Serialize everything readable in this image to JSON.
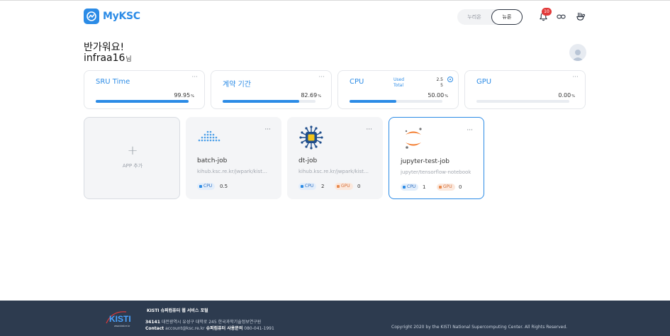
{
  "header": {
    "logo_text": "MyKSC",
    "toggle": {
      "left_label": "누리온",
      "right_label": "뉴론",
      "active": "뉴론"
    },
    "notification_count": "10",
    "icons": [
      "bell-icon",
      "link-icon",
      "user-menu-icon"
    ]
  },
  "greeting": {
    "line1": "반가워요!",
    "username": "infraa16",
    "suffix": "님"
  },
  "stats": [
    {
      "title": "SRU Time",
      "value": "99.95",
      "unit": "%",
      "progress": 0.9995
    },
    {
      "title": "계약 기간",
      "value": "82.69",
      "unit": "%",
      "progress": 0.8269
    },
    {
      "title": "CPU",
      "used_label": "Used",
      "used_value": "2.5",
      "total_label": "Total",
      "total_value": "5",
      "value": "50.00",
      "unit": "%",
      "progress": 0.5
    },
    {
      "title": "GPU",
      "value": "0.00",
      "unit": "%",
      "progress": 0
    }
  ],
  "more_glyph": "···",
  "add_app": {
    "plus": "+",
    "label": "APP 추가"
  },
  "apps": [
    {
      "name": "batch-job",
      "url": "kihub.ksc.re.kr/jwpark/kisti-batch",
      "cpu_label": "CPU",
      "cpu": "0.5",
      "icon": "batch-icon"
    },
    {
      "name": "dt-job",
      "url": "kihub.ksc.re.kr/jwpark/kisti-dt",
      "cpu_label": "CPU",
      "cpu": "2",
      "gpu_label": "GPU",
      "gpu": "0",
      "icon": "circuit-chip-icon"
    },
    {
      "name": "jupyter-test-job",
      "url": "jupyter/tensorflow-notebook",
      "cpu_label": "CPU",
      "cpu": "1",
      "gpu_label": "GPU",
      "gpu": "0",
      "icon": "jupyter-icon",
      "selected": true
    }
  ],
  "footer": {
    "title": "KISTI 슈퍼컴퓨터 웹 서비스 포털",
    "address_label": "34141",
    "address": "대전광역시 유성구 대학로 245 한국과학기술정보연구원",
    "contact_label": "Contact",
    "contact_email": "account@ksc.re.kr",
    "inquiry_label": "슈퍼컴퓨터 사용문의",
    "phone": "080-041-1991",
    "copyright": "Copyright 2020 by the KISTI National Supercomputing Center. All Rights Reserved.",
    "logo_text": "KISTI",
    "logo_sub": "www.kisti.re.kr"
  },
  "colors": {
    "accent": "#2b8be6",
    "footer_bg": "#2d3b4f",
    "badge": "#e23a3a",
    "gpu": "#e98a4d"
  }
}
